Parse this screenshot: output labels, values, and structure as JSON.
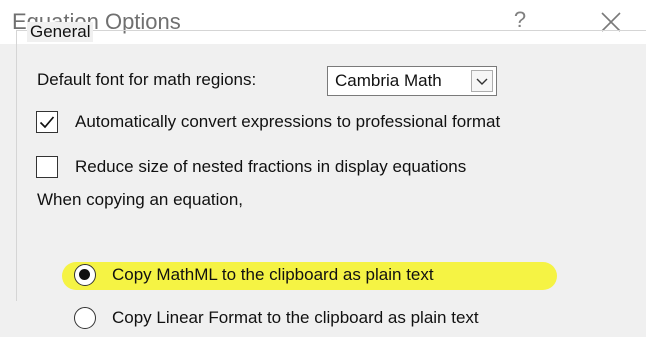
{
  "dialog": {
    "title": "Equation Options",
    "help_label": "?",
    "close_icon": "close-icon"
  },
  "general": {
    "group_label": "General",
    "default_font_label": "Default font for math regions:",
    "default_font_value": "Cambria Math",
    "auto_convert": {
      "label": "Automatically convert expressions to professional format",
      "checked": true
    },
    "reduce_size": {
      "label": "Reduce size of nested fractions in display equations",
      "checked": false
    },
    "copying_label": "When copying an equation,",
    "copy_options": [
      {
        "label": "Copy MathML to the clipboard as plain text",
        "selected": true
      },
      {
        "label": "Copy Linear Format to the clipboard as plain text",
        "selected": false
      }
    ]
  },
  "annotation": {
    "highlight_color": "#f4f23a"
  }
}
